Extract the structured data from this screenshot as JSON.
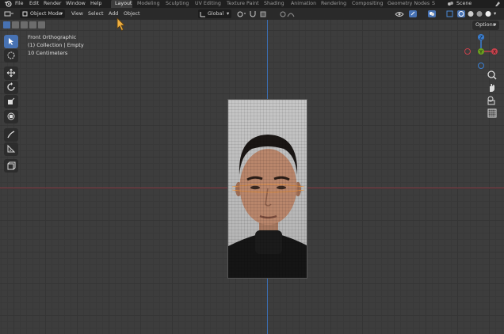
{
  "menubar": {
    "menus": [
      "File",
      "Edit",
      "Render",
      "Window",
      "Help"
    ],
    "workspaces": [
      "Layout",
      "Modeling",
      "Sculpting",
      "UV Editing",
      "Texture Paint",
      "Shading",
      "Animation",
      "Rendering",
      "Compositing",
      "Geometry Nodes",
      "S"
    ],
    "active_workspace": "Layout",
    "scene_label": "Scene"
  },
  "header": {
    "mode": "Object Mode",
    "menus": [
      "View",
      "Select",
      "Add",
      "Object"
    ],
    "transform_orientation": "Global"
  },
  "viewport": {
    "view_name": "Front Orthographic",
    "collection_info": "(1) Collection | Empty",
    "scale_info": "10 Centimeters",
    "options_label": "Options",
    "gizmo_axes": [
      "X",
      "Y",
      "Z"
    ]
  },
  "colors": {
    "accent": "#4772b3",
    "x_axis": "#c4414b",
    "y_axis": "#6a9f1e",
    "z_axis": "#3b7fd1",
    "cursor": "#f0b040"
  }
}
